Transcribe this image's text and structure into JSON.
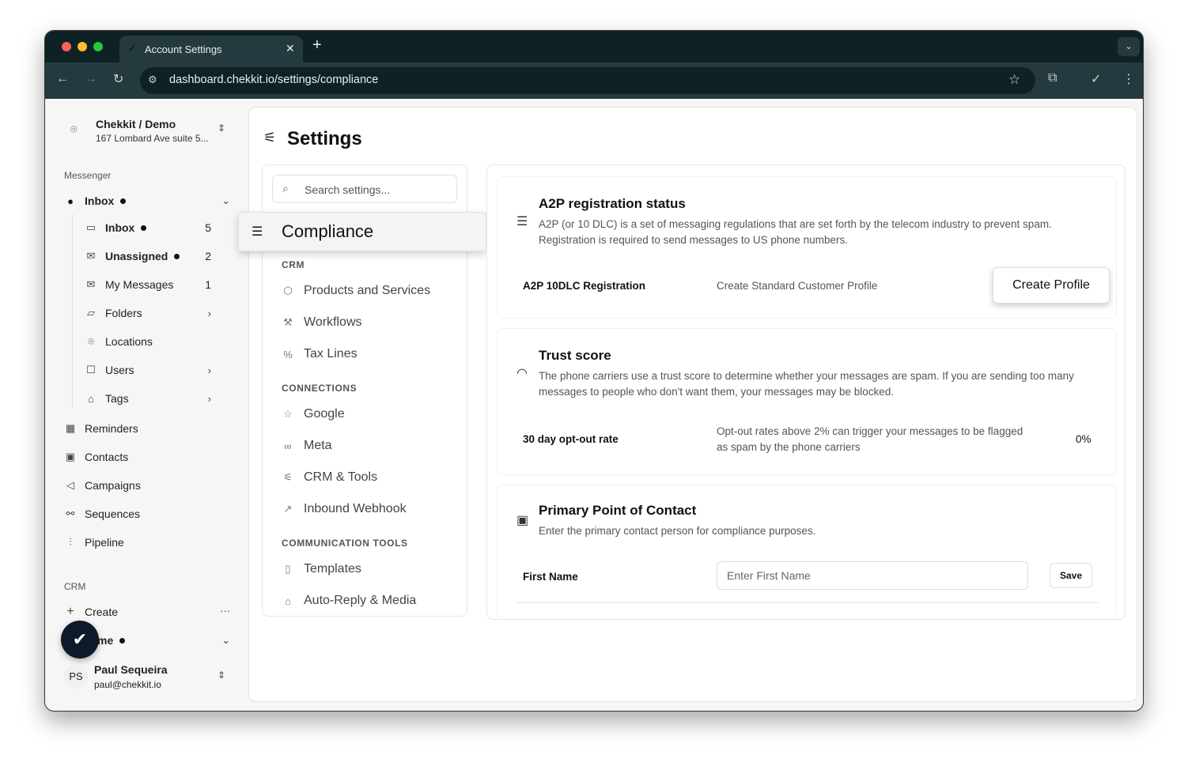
{
  "browser": {
    "tab_title": "Account Settings",
    "url": "dashboard.chekkit.io/settings/compliance"
  },
  "sidebar": {
    "org_name": "Chekkit / Demo",
    "org_address": "167 Lombard Ave suite 5...",
    "messenger_label": "Messenger",
    "inbox_group": "Inbox",
    "items": [
      {
        "label": "Inbox",
        "count": "5",
        "dot": true
      },
      {
        "label": "Unassigned",
        "count": "2",
        "dot": true
      },
      {
        "label": "My Messages",
        "count": "1"
      },
      {
        "label": "Folders"
      },
      {
        "label": "Locations"
      },
      {
        "label": "Users"
      },
      {
        "label": "Tags"
      }
    ],
    "main_items": [
      "Reminders",
      "Contacts",
      "Campaigns",
      "Sequences",
      "Pipeline"
    ],
    "crm_label": "CRM",
    "create_label": "Create",
    "home_label": "me",
    "user": {
      "initials": "PS",
      "name": "Paul Sequeira",
      "email": "paul@chekkit.io"
    }
  },
  "settings": {
    "title": "Settings",
    "search_placeholder": "Search settings...",
    "active": "Compliance",
    "sections": [
      {
        "heading": "CRM",
        "items": [
          "Products and Services",
          "Workflows",
          "Tax Lines"
        ]
      },
      {
        "heading": "CONNECTIONS",
        "items": [
          "Google",
          "Meta",
          "CRM & Tools",
          "Inbound Webhook"
        ]
      },
      {
        "heading": "COMMUNICATION TOOLS",
        "items": [
          "Templates",
          "Auto-Reply & Media"
        ]
      }
    ]
  },
  "compliance": {
    "a2p": {
      "title": "A2P registration status",
      "desc": "A2P (or 10 DLC) is a set of messaging regulations that are set forth by the telecom industry to prevent spam. Registration is required to send messages to US phone numbers.",
      "row_label": "A2P 10DLC Registration",
      "row_value": "Create Standard Customer Profile",
      "button": "Create Profile"
    },
    "trust": {
      "title": "Trust score",
      "desc": "The phone carriers use a trust score to determine whether your messages are spam. If you are sending too many messages to people who don't want them, your messages may be blocked.",
      "row_label": "30 day opt-out rate",
      "row_value": "Opt-out rates above 2% can trigger your messages to be flagged as spam by the phone carriers",
      "rate": "0%"
    },
    "contact": {
      "title": "Primary Point of Contact",
      "desc": "Enter the primary contact person for compliance purposes.",
      "field_label": "First Name",
      "placeholder": "Enter First Name",
      "save": "Save"
    }
  }
}
